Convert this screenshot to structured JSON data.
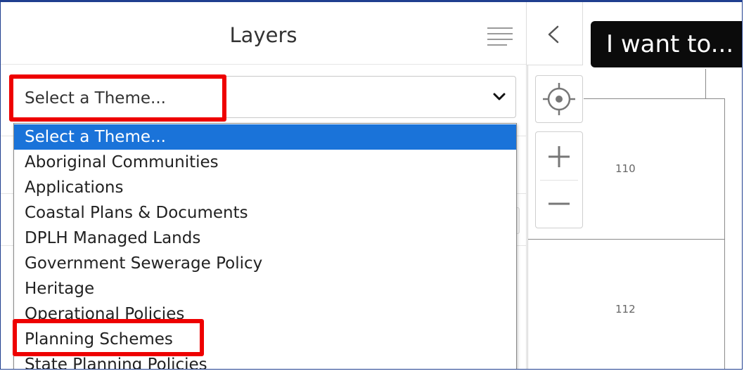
{
  "layers_panel": {
    "title": "Layers",
    "theme_select": {
      "selected_value": "Select a Theme...",
      "options": [
        "Select a Theme...",
        "Aboriginal Communities",
        "Applications",
        "Coastal Plans & Documents",
        "DPLH Managed Lands",
        "Government Sewerage Policy",
        "Heritage",
        "Operational Policies",
        "Planning Schemes",
        "State Planning Policies"
      ]
    }
  },
  "map": {
    "i_want_to_label": "I want to...",
    "parcel_labels": [
      "110",
      "112"
    ]
  },
  "icons": [
    "menu-icon",
    "chevron-down-icon",
    "chevron-left-icon",
    "locate-icon",
    "plus-icon",
    "minus-icon"
  ],
  "colors": {
    "highlight": "#ee0000",
    "selected_option": "#1a73d9",
    "frame_border": "#1f3f8f"
  }
}
